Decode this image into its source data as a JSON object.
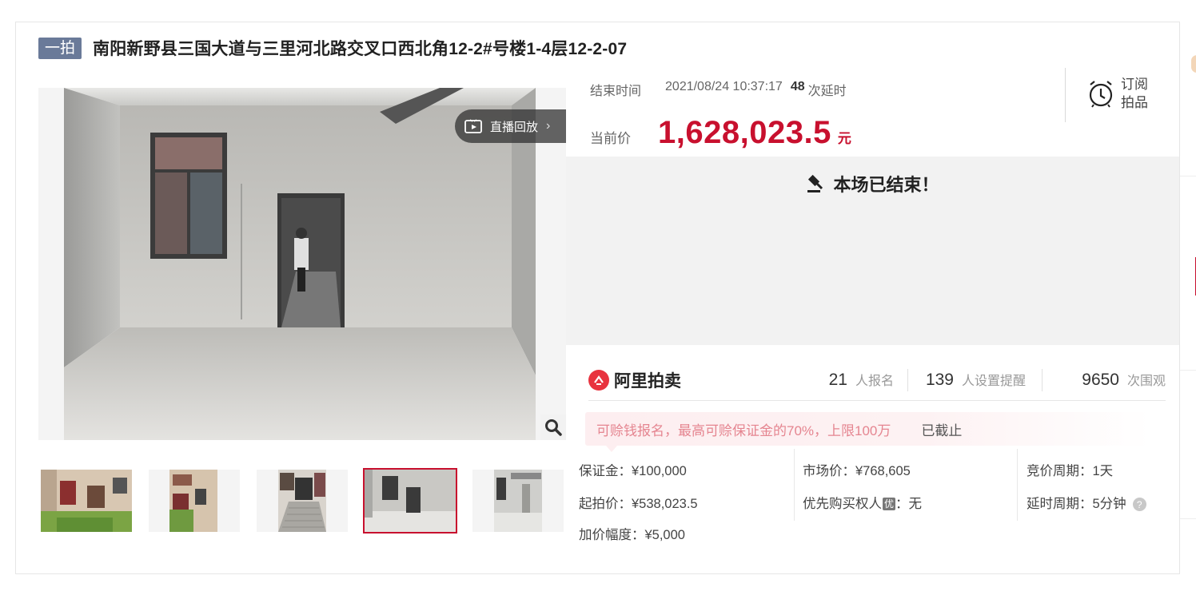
{
  "title": {
    "tag": "一拍",
    "text": "南阳新野县三国大道与三里河北路交叉口西北角12-2#号楼1-4层12-2-07"
  },
  "media": {
    "replay_label": "直播回放",
    "replay_arrow": "›",
    "thumbnails_count": 5,
    "selected_thumbnail": 4
  },
  "auction": {
    "end_time_label": "结束时间",
    "end_time_value": "2021/08/24 10:37:17",
    "delay_count": "48",
    "delay_label": "次延时",
    "current_price_label": "当前价",
    "current_price": "1,628,023.5",
    "price_unit": "元",
    "subscribe_line1": "订阅",
    "subscribe_line2": "拍品",
    "ended_message": "本场已结束！"
  },
  "stats": {
    "brand": "阿里拍卖",
    "signups_num": "21",
    "signups_label": "人报名",
    "reminders_num": "139",
    "reminders_label": "人设置提醒",
    "views_num": "9650",
    "views_label": "次围观"
  },
  "notice": {
    "text": "可赊钱报名，最高可赊保证金的70%，上限100万",
    "status": "已截止"
  },
  "details": {
    "deposit": "保证金：¥100,000",
    "start_price": "起拍价：¥538,023.5",
    "increment": "加价幅度：¥5,000",
    "market_price": "市场价：¥768,605",
    "priority_label": "优先购买权人",
    "priority_badge": "优",
    "priority_value": "：无",
    "cycle": "竞价周期：1天",
    "delay_cycle": "延时周期：5分钟",
    "help_glyph": "?"
  },
  "colors": {
    "accent_red": "#c8102e",
    "tag_bg": "#6a7a99",
    "notice_pink": "#e58590",
    "brand_red": "#e8333f"
  }
}
